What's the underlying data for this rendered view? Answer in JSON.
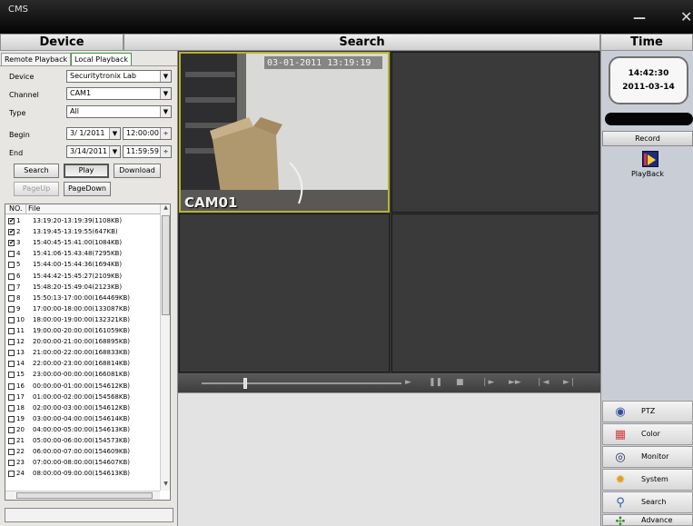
{
  "app": {
    "title": "CMS"
  },
  "headers": {
    "device": "Device",
    "search": "Search",
    "time": "Time"
  },
  "left": {
    "tabs": [
      "Remote Playback",
      "Local Playback"
    ],
    "form": {
      "device_label": "Device",
      "device_value": "Securitytronix Lab",
      "channel_label": "Channel",
      "channel_value": "CAM1",
      "type_label": "Type",
      "type_value": "All",
      "begin_label": "Begin",
      "begin_date": "3/ 1/2011",
      "begin_time": "12:00:00",
      "end_label": "End",
      "end_date": "3/14/2011",
      "end_time": "11:59:59"
    },
    "buttons": {
      "search": "Search",
      "play": "Play",
      "download": "Download",
      "pageup": "PageUp",
      "pagedown": "PageDown"
    },
    "list_headers": {
      "no": "NO.",
      "file": "File"
    },
    "files": [
      {
        "no": "1",
        "checked": true,
        "name": "13:19:20-13:19:39(1108KB)"
      },
      {
        "no": "2",
        "checked": true,
        "name": "13:19:45-13:19:55(647KB)"
      },
      {
        "no": "3",
        "checked": true,
        "name": "15:40:45-15:41:00(1084KB)"
      },
      {
        "no": "4",
        "checked": false,
        "name": "15:41:06-15:43:48(7295KB)"
      },
      {
        "no": "5",
        "checked": false,
        "name": "15:44:00-15:44:36(1694KB)"
      },
      {
        "no": "6",
        "checked": false,
        "name": "15:44:42-15:45:27(2109KB)"
      },
      {
        "no": "7",
        "checked": false,
        "name": "15:48:20-15:49:04(2123KB)"
      },
      {
        "no": "8",
        "checked": false,
        "name": "15:50:13-17:00:00(164469KB)"
      },
      {
        "no": "9",
        "checked": false,
        "name": "17:00:00-18:00:00(133087KB)"
      },
      {
        "no": "10",
        "checked": false,
        "name": "18:00:00-19:00:00(132321KB)"
      },
      {
        "no": "11",
        "checked": false,
        "name": "19:00:00-20:00:00(161059KB)"
      },
      {
        "no": "12",
        "checked": false,
        "name": "20:00:00-21:00:00(168895KB)"
      },
      {
        "no": "13",
        "checked": false,
        "name": "21:00:00-22:00:00(168833KB)"
      },
      {
        "no": "14",
        "checked": false,
        "name": "22:00:00-23:00:00(168814KB)"
      },
      {
        "no": "15",
        "checked": false,
        "name": "23:00:00-00:00:00(166081KB)"
      },
      {
        "no": "16",
        "checked": false,
        "name": "00:00:00-01:00:00(154612KB)"
      },
      {
        "no": "17",
        "checked": false,
        "name": "01:00:00-02:00:00(154568KB)"
      },
      {
        "no": "18",
        "checked": false,
        "name": "02:00:00-03:00:00(154612KB)"
      },
      {
        "no": "19",
        "checked": false,
        "name": "03:00:00-04:00:00(154614KB)"
      },
      {
        "no": "20",
        "checked": false,
        "name": "04:00:00-05:00:00(154613KB)"
      },
      {
        "no": "21",
        "checked": false,
        "name": "05:00:00-06:00:00(154573KB)"
      },
      {
        "no": "22",
        "checked": false,
        "name": "06:00:00-07:00:00(154609KB)"
      },
      {
        "no": "23",
        "checked": false,
        "name": "07:00:00-08:00:00(154607KB)"
      },
      {
        "no": "24",
        "checked": false,
        "name": "08:00:00-09:00:00(154613KB)"
      }
    ]
  },
  "video": {
    "osd": "03-01-2011 13:19:19",
    "camera_label": "CAM01"
  },
  "playback_controls": [
    "play",
    "pause",
    "stop",
    "slow",
    "fast",
    "prev-frame",
    "next-frame"
  ],
  "right": {
    "clock_time": "14:42:30",
    "clock_date": "2011-03-14",
    "record_label": "Record",
    "playback_label": "PlayBack",
    "nav": [
      {
        "label": "PTZ",
        "icon": "ptz-icon"
      },
      {
        "label": "Color",
        "icon": "color-icon"
      },
      {
        "label": "Monitor",
        "icon": "monitor-eye-icon"
      },
      {
        "label": "System",
        "icon": "system-gear-icon"
      },
      {
        "label": "Search",
        "icon": "search-magnifier-icon"
      },
      {
        "label": "Advance",
        "icon": "advance-icon"
      }
    ]
  }
}
